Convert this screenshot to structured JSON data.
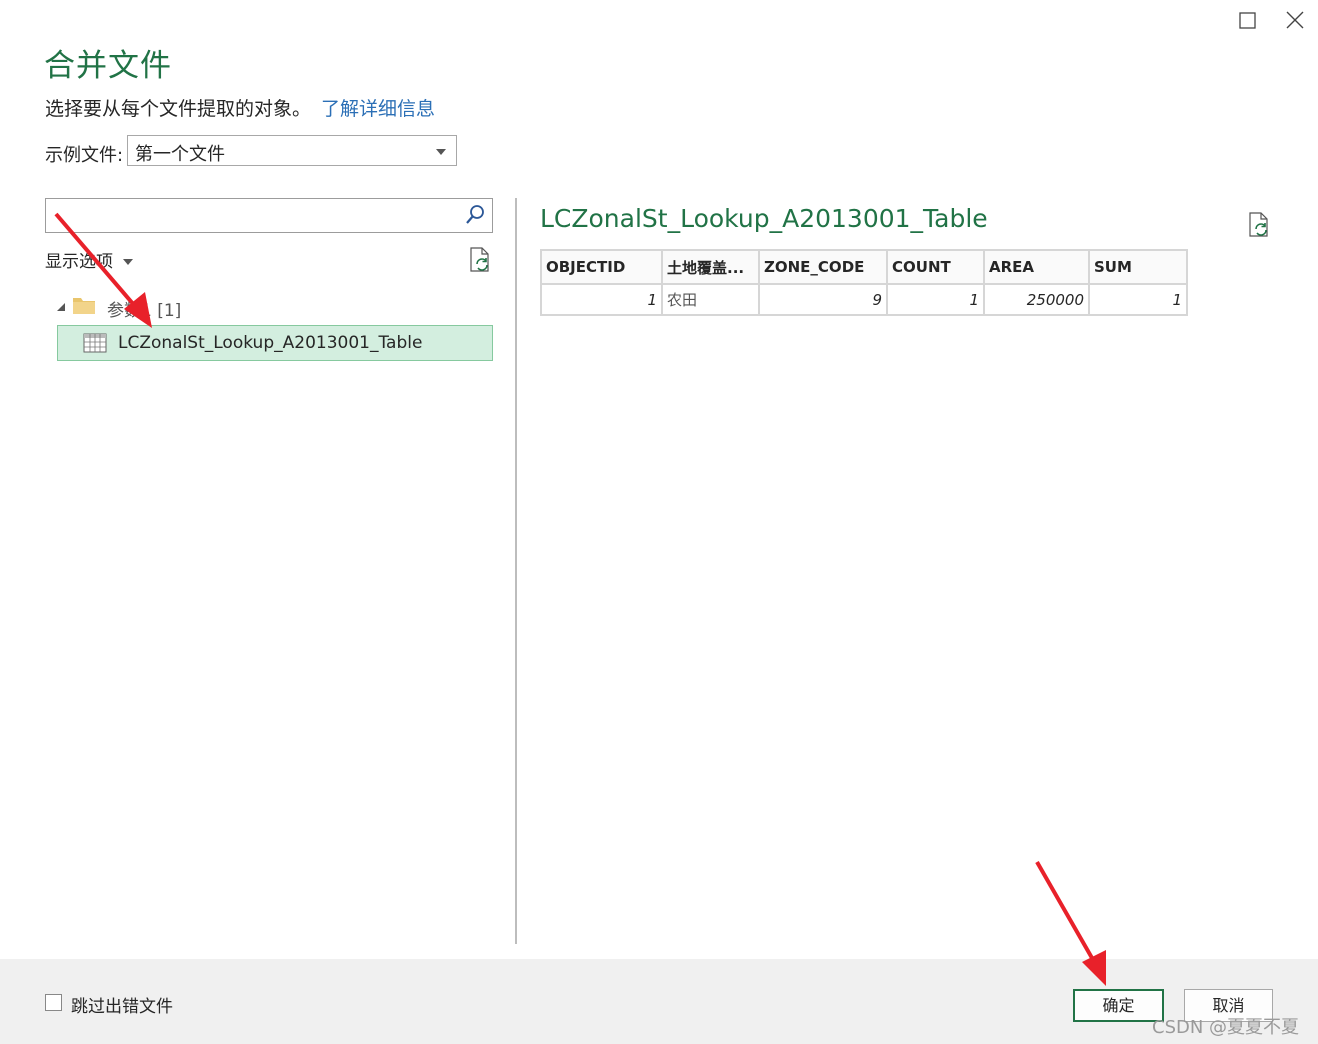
{
  "window": {
    "maximize_icon": "maximize-icon",
    "close_icon": "close-icon"
  },
  "dialog": {
    "title": "合并文件",
    "subtitle": "选择要从每个文件提取的对象。",
    "learn_more_link": "了解详细信息"
  },
  "sample_file": {
    "label": "示例文件:",
    "selected": "第一个文件"
  },
  "navigator": {
    "search_placeholder": "",
    "display_options_label": "显示选项",
    "folder": {
      "label": "参数1 [1]",
      "expanded": true
    },
    "items": [
      {
        "label": "LCZonalSt_Lookup_A2013001_Table",
        "selected": true
      }
    ]
  },
  "preview": {
    "title": "LCZonalSt_Lookup_A2013001_Table",
    "columns": [
      "OBJECTID",
      "土地覆盖...",
      "ZONE_CODE",
      "COUNT",
      "AREA",
      "SUM"
    ],
    "rows": [
      [
        "1",
        "农田",
        "9",
        "1",
        "250000",
        "1"
      ]
    ]
  },
  "footer": {
    "skip_errors_label": "跳过出错文件",
    "skip_errors_checked": false,
    "ok_label": "确定",
    "cancel_label": "取消"
  },
  "watermark": "CSDN @夏夏不夏",
  "colors": {
    "accent": "#217346",
    "link": "#2b6fb6",
    "selection_bg": "#d3eedf",
    "annotation_arrow": "#e8212a"
  }
}
